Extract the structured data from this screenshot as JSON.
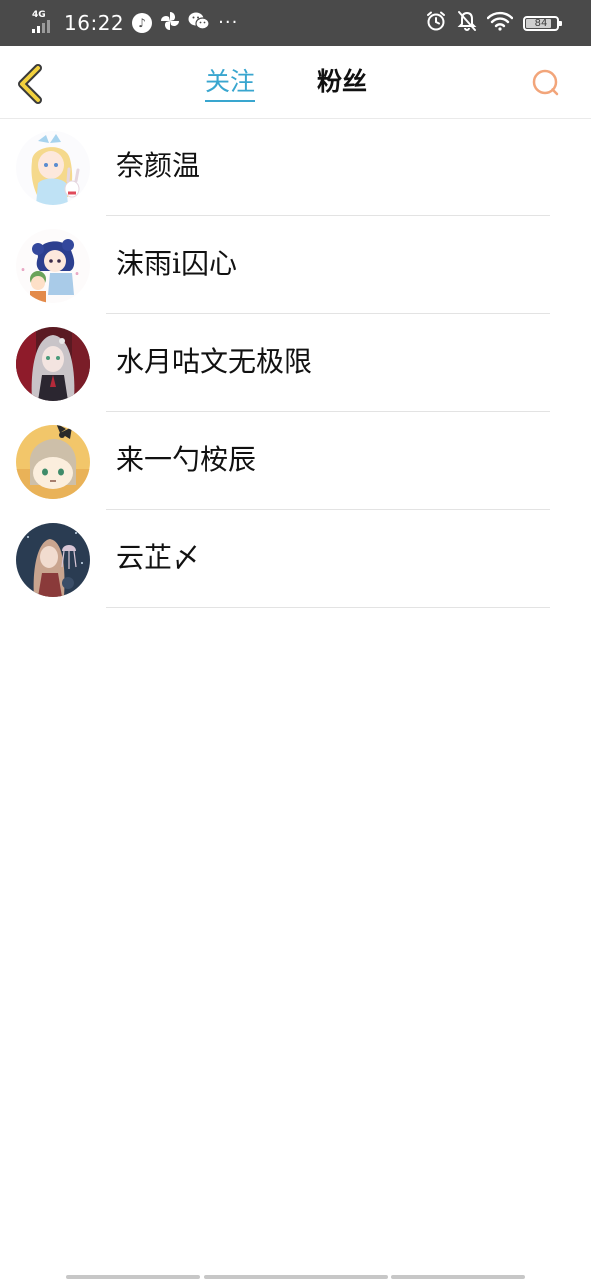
{
  "status_bar": {
    "network": "4G",
    "time": "16:22",
    "more": "···",
    "battery": "84",
    "battery_level": 0.84
  },
  "header": {
    "tabs": [
      {
        "label": "关注",
        "active": true
      },
      {
        "label": "粉丝",
        "active": false
      }
    ],
    "accent_color": "#39a6cf",
    "back_icon": "chevron-left-icon",
    "search_icon": "search-icon"
  },
  "users": [
    {
      "name": "奈颜温",
      "avatar": "avatar-blonde-girl-with-bunny"
    },
    {
      "name": "沫雨i囚心",
      "avatar": "avatar-blue-hair-girl"
    },
    {
      "name": "水月咕文无极限",
      "avatar": "avatar-silver-hair-girl"
    },
    {
      "name": "来一勺桉辰",
      "avatar": "avatar-chibi-girl-with-bow"
    },
    {
      "name": "云芷〆",
      "avatar": "avatar-girl-with-jellyfish"
    }
  ]
}
